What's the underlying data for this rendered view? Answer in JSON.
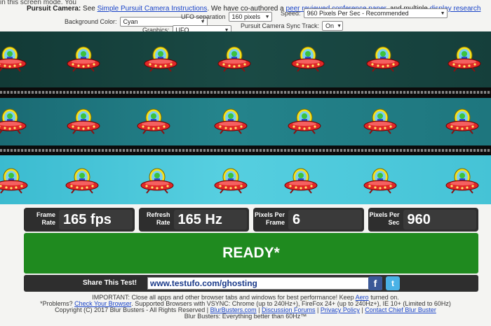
{
  "header": {
    "intro_fragment": "in this screen mode. You",
    "pursuit_label": "Pursuit Camera:",
    "pursuit_see": "See",
    "pursuit_link": "Simple Pursuit Camera Instructions",
    "pursuit_tail": ". We have co-authored a",
    "paper_link": "peer reviewed conference paper",
    "paper_tail": ", and multiple",
    "other_link": "display research"
  },
  "controls": {
    "ufo_separation_label": "UFO separation",
    "ufo_separation_value": "160 pixels",
    "speed_label": "Speed:",
    "speed_value": "960 Pixels Per Sec - Recommended",
    "background_label": "Background Color:",
    "background_value": "Cyan",
    "graphics_label": "Graphics:",
    "graphics_value": "UFO",
    "sync_label": "Pursuit Camera Sync Track:",
    "sync_value": "On"
  },
  "stats": [
    {
      "label": "Frame Rate",
      "value": "165 fps"
    },
    {
      "label": "Refresh Rate",
      "value": "165 Hz"
    },
    {
      "label": "Pixels Per Frame",
      "value": "6"
    },
    {
      "label": "Pixels Per Sec",
      "value": "960"
    }
  ],
  "status": {
    "ready": "READY*"
  },
  "share": {
    "label": "Share This Test!",
    "url": "www.testufo.com/ghosting"
  },
  "footer": {
    "important": "IMPORTANT: Close all apps and other browser tabs and windows for best performance! Keep",
    "aero_link": "Aero",
    "aero_tail": "turned on.",
    "problems": "*Problems?",
    "check_browser_link": "Check Your Browser",
    "supported": ". Supported Browsers with VSYNC: Chrome (up to 240Hz+), FireFox 24+ (up to 240Hz+), IE 10+ (Limited to 60Hz)",
    "copyright": "Copyright (C) 2017 Blur Busters - All Rights Reserved |",
    "blurbusters_link": "BlurBusters.com",
    "forums_link": "Discussion Forums",
    "privacy_link": "Privacy Policy",
    "contact_link": "Contact Chief Blur Buster",
    "sep": "|",
    "tagline": "Blur Busters: Everything better than 60Hz™"
  },
  "colors": {
    "lane1": "#123a36",
    "lane2": "#24848c",
    "lane3": "#56cfe0",
    "ready_green": "#1f8a1f",
    "stat_bg": "#2e2e2e",
    "link": "#1a44c8"
  },
  "icons": {
    "ufo": "ufo-icon",
    "facebook": "facebook-icon",
    "twitter": "twitter-icon"
  }
}
